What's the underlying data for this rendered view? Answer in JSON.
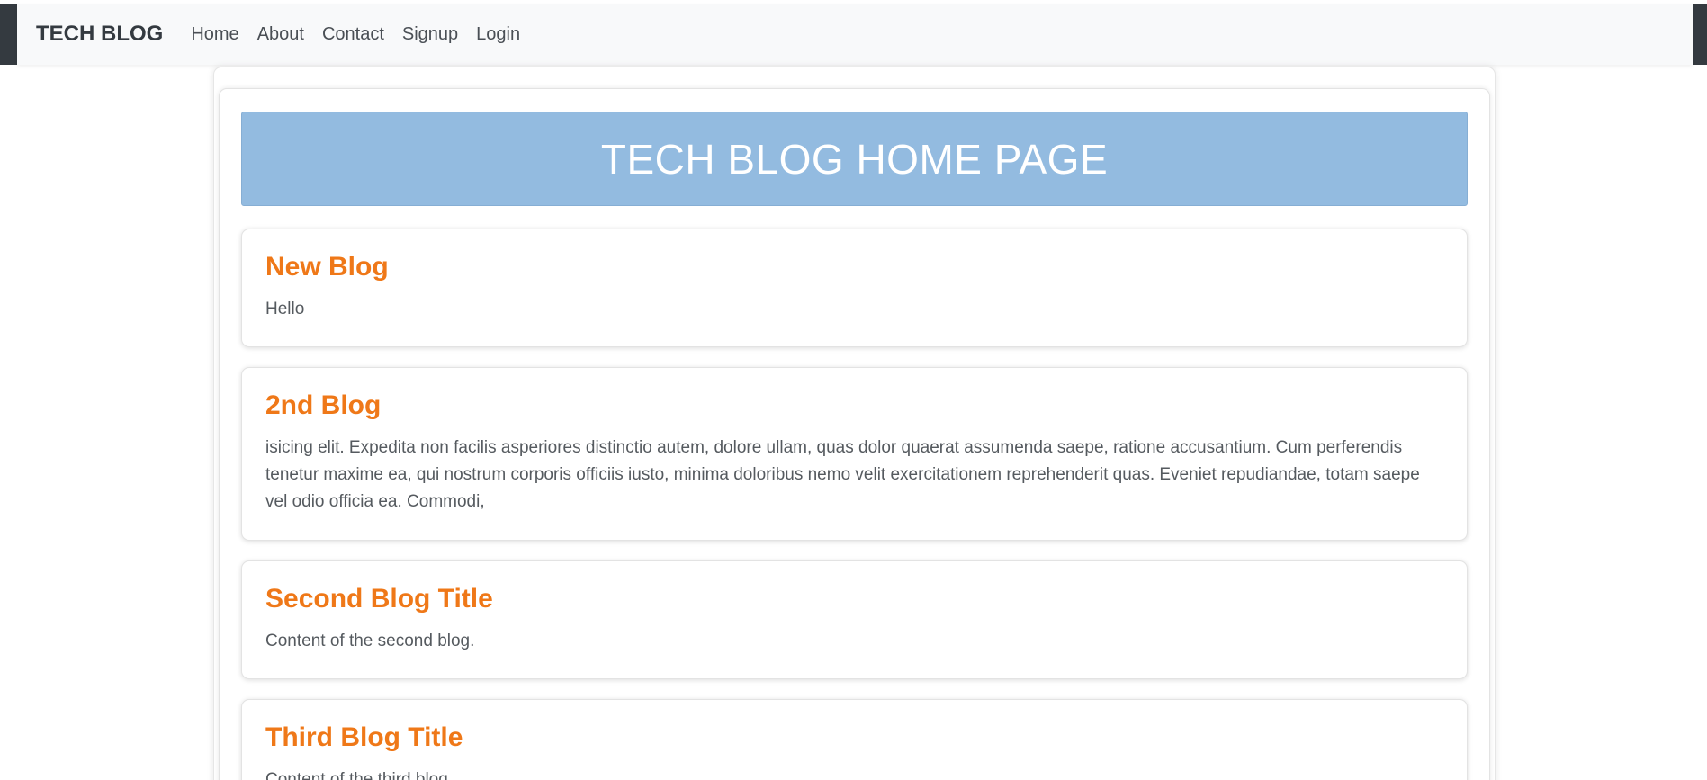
{
  "navbar": {
    "brand": "TECH BLOG",
    "links": [
      "Home",
      "About",
      "Contact",
      "Signup",
      "Login"
    ]
  },
  "hero": {
    "title": "TECH BLOG HOME PAGE"
  },
  "posts": [
    {
      "title": "New Blog",
      "body": "Hello"
    },
    {
      "title": "2nd Blog",
      "body": "isicing elit. Expedita non facilis asperiores distinctio autem, dolore ullam, quas dolor quaerat assumenda saepe, ratione accusantium. Cum perferendis tenetur maxime ea, qui nostrum corporis officiis iusto, minima doloribus nemo velit exercitationem reprehenderit quas. Eveniet repudiandae, totam saepe vel odio officia ea. Commodi,"
    },
    {
      "title": "Second Blog Title",
      "body": "Content of the second blog."
    },
    {
      "title": "Third Blog Title",
      "body": "Content of the third blog."
    }
  ],
  "colors": {
    "navbar_bg": "#f8f9fa",
    "edge_dark": "#343a40",
    "hero_bg": "#93bbe0",
    "post_title": "#ef7818",
    "post_body": "#555a5f"
  }
}
